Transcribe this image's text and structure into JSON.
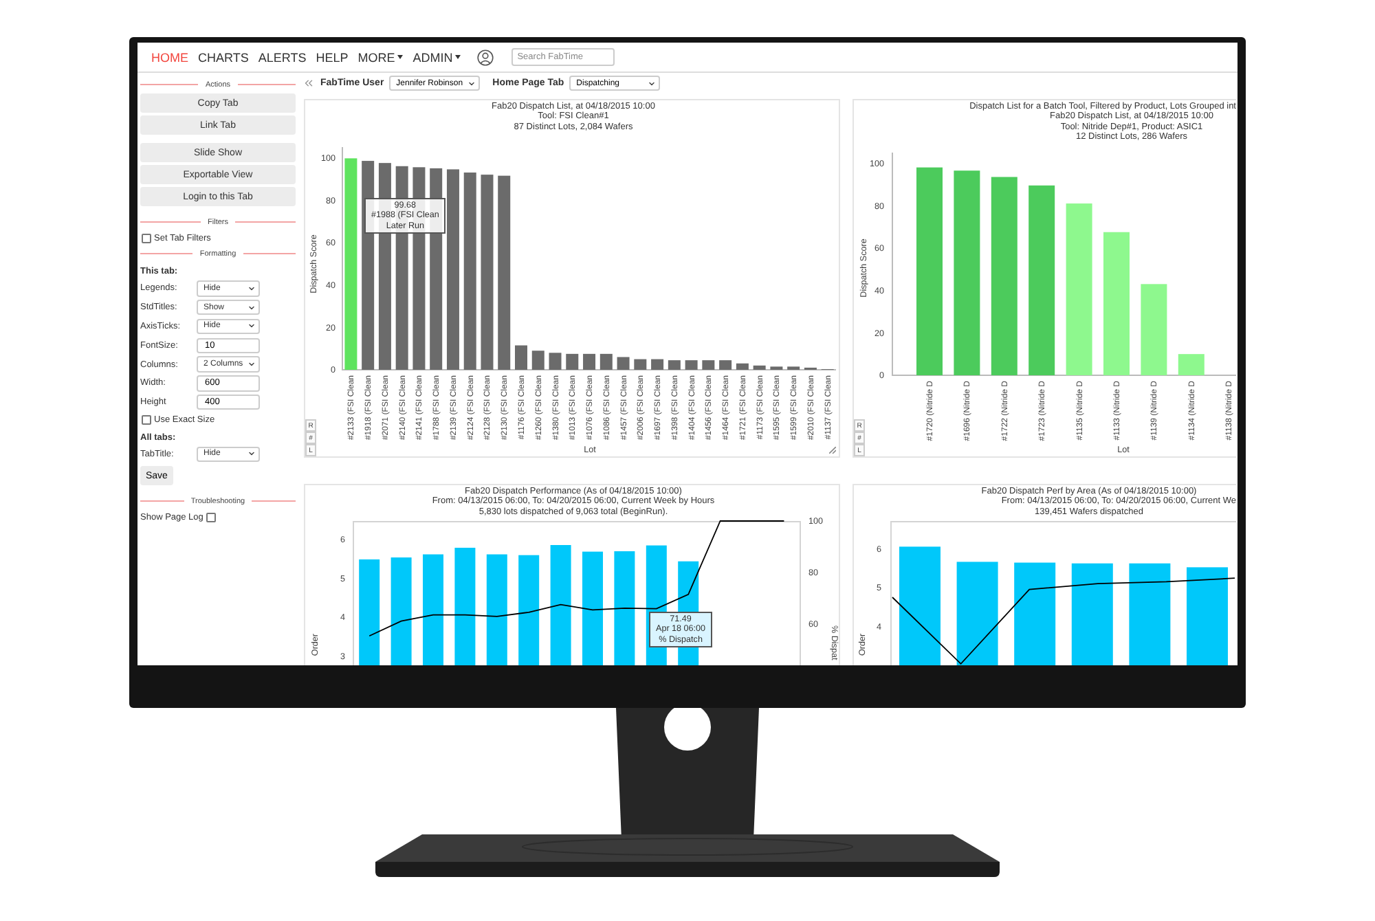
{
  "nav": {
    "items": [
      {
        "label": "HOME",
        "selected": true,
        "dropdown": false
      },
      {
        "label": "CHARTS",
        "selected": false,
        "dropdown": false
      },
      {
        "label": "ALERTS",
        "selected": false,
        "dropdown": false
      },
      {
        "label": "HELP",
        "selected": false,
        "dropdown": false
      },
      {
        "label": "MORE",
        "selected": false,
        "dropdown": true
      },
      {
        "label": "ADMIN",
        "selected": false,
        "dropdown": true
      }
    ],
    "search": {
      "placeholder": "Search FabTime"
    }
  },
  "sidebar": {
    "sections": [
      {
        "title": "Actions",
        "items": [
          {
            "kind": "button-group",
            "buttons": [
              "Copy Tab",
              "Link Tab"
            ]
          },
          {
            "kind": "button-group",
            "buttons": [
              "Slide Show",
              "Exportable View",
              "Login to this Tab"
            ]
          }
        ]
      },
      {
        "title": "Filters",
        "items": [
          {
            "kind": "checkbox",
            "label": "Set Tab Filters",
            "checked": false
          }
        ]
      },
      {
        "title": "Formatting",
        "items": [
          {
            "kind": "heading",
            "text": "This tab:"
          },
          {
            "kind": "select",
            "label": "Legends:",
            "value": "Hide"
          },
          {
            "kind": "select",
            "label": "StdTitles:",
            "value": "Show"
          },
          {
            "kind": "select",
            "label": "AxisTicks:",
            "value": "Hide"
          },
          {
            "kind": "input",
            "label": "FontSize:",
            "value": "10"
          },
          {
            "kind": "select",
            "label": "Columns:",
            "value": "2 Columns"
          },
          {
            "kind": "input",
            "label": "Width:",
            "value": "600"
          },
          {
            "kind": "input",
            "label": "Height",
            "value": "400"
          },
          {
            "kind": "checkbox",
            "label": "Use Exact Size",
            "checked": false
          },
          {
            "kind": "heading",
            "text": "All tabs:"
          },
          {
            "kind": "select",
            "label": "TabTitle:",
            "value": "Hide"
          },
          {
            "kind": "submit",
            "label": "Save"
          }
        ]
      },
      {
        "title": "Troubleshooting",
        "items": [
          {
            "kind": "checkbox-right",
            "label": "Show Page Log",
            "checked": false
          }
        ]
      }
    ]
  },
  "toolbar": {
    "fields": [
      {
        "label": "FabTime User",
        "value": "Jennifer Robinson"
      },
      {
        "label": "Home Page Tab",
        "value": "Dispatching"
      }
    ]
  },
  "charts": [
    {
      "title_lines": [
        "Fab20 Dispatch List, at 04/18/2015 10:00",
        "Tool: FSI Clean#1",
        "87 Distinct Lots, 2,084 Wafers"
      ],
      "side_buttons": [
        "R",
        "#",
        "L"
      ],
      "chart_data": {
        "type": "bar",
        "xlabel": "Lot",
        "ylabel": "Dispatch Score",
        "ylim": [
          0,
          105
        ],
        "yticks": [
          0,
          20,
          40,
          60,
          80,
          100
        ],
        "categories": [
          "#2133 (FSI Clean",
          "#1918 (FSI Clean",
          "#2071 (FSI Clean",
          "#2140 (FSI Clean",
          "#2141 (FSI Clean",
          "#1788 (FSI Clean",
          "#2139 (FSI Clean",
          "#2124 (FSI Clean",
          "#2128 (FSI Clean",
          "#2130 (FSI Clean",
          "#1176 (FSI Clean",
          "#1260 (FSI Clean",
          "#1380 (FSI Clean",
          "#1013 (FSI Clean",
          "#1076 (FSI Clean",
          "#1086 (FSI Clean",
          "#1457 (FSI Clean",
          "#2006 (FSI Clean",
          "#1697 (FSI Clean",
          "#1398 (FSI Clean",
          "#1404 (FSI Clean",
          "#1456 (FSI Clean",
          "#1464 (FSI Clean",
          "#1721 (FSI Clean",
          "#1173 (FSI Clean",
          "#1595 (FSI Clean",
          "#1599 (FSI Clean",
          "#2010 (FSI Clean",
          "#1137 (FSI Clean"
        ],
        "series": [
          {
            "color": "#5ee35e",
            "values": [
              99.7,
              null,
              null,
              null,
              null,
              null,
              null,
              null,
              null,
              null,
              null,
              null,
              null,
              null,
              null,
              null,
              null,
              null,
              null,
              null,
              null,
              null,
              null,
              null,
              null,
              null,
              null,
              null,
              null
            ]
          },
          {
            "color": "#6b6b6b",
            "values": [
              null,
              98.5,
              97.5,
              96,
              95.5,
              95,
              94.5,
              93,
              92,
              91.5,
              11.5,
              9,
              8,
              7.5,
              7.5,
              7.5,
              6,
              5,
              5,
              4.5,
              4.5,
              4.5,
              4.5,
              3,
              2,
              1.5,
              1.5,
              1,
              0.3
            ]
          }
        ],
        "annotations": [
          {
            "text": "99.68\n#1988 (FSI Clean\nLater Run"
          }
        ]
      }
    },
    {
      "title_lines": [
        "Dispatch List for a Batch Tool, Filtered by Product, Lots Grouped int",
        "Fab20 Dispatch List, at 04/18/2015 10:00",
        "Tool: Nitride Dep#1, Product: ASIC1",
        "12 Distinct Lots, 286 Wafers"
      ],
      "side_buttons": [
        "R",
        "#",
        "L"
      ],
      "chart_data": {
        "type": "bar",
        "xlabel": "Lot",
        "ylabel": "Dispatch Score",
        "ylim": [
          0,
          105
        ],
        "yticks": [
          0,
          20,
          40,
          60,
          80,
          100
        ],
        "categories": [
          "#1720 (Nitride D",
          "#1696 (Nitride D",
          "#1722 (Nitride D",
          "#1723 (Nitride D",
          "#1135 (Nitride D",
          "#1133 (Nitride D",
          "#1139 (Nitride D",
          "#1134 (Nitride D",
          "#1138 (Nitride D"
        ],
        "series": [
          {
            "color": "#4ccb5c",
            "values": [
              98,
              96.5,
              93.5,
              89.5,
              null,
              null,
              null,
              null,
              null
            ]
          },
          {
            "color": "#8ef88e",
            "values": [
              null,
              null,
              null,
              null,
              81,
              67.5,
              43,
              10,
              null
            ]
          }
        ]
      }
    },
    {
      "title_lines": [
        "Fab20 Dispatch Performance  (As of 04/18/2015 10:00)",
        "From: 04/13/2015 06:00, To: 04/20/2015 06:00, Current Week by Hours",
        "5,830 lots dispatched of 9,063 total (BeginRun)."
      ],
      "chart_data": {
        "type": "bar",
        "ylabel": "Order",
        "y2label": "% Dispat",
        "ylim": [
          2.76,
          6.48
        ],
        "yticks": [
          3,
          4,
          5,
          6
        ],
        "y2lim": [
          44,
          100
        ],
        "y2ticks": [
          60,
          80,
          100
        ],
        "series": [
          {
            "type": "bar",
            "color": "#00c8fa",
            "values": [
              5.49,
              5.54,
              5.62,
              5.79,
              5.62,
              5.6,
              5.86,
              5.69,
              5.7,
              5.85,
              5.44,
              null,
              null,
              null
            ]
          },
          {
            "type": "line",
            "axis": "y2",
            "color": "#000000",
            "values": [
              55.4,
              61.2,
              63.6,
              63.6,
              63,
              64.6,
              67.6,
              65.5,
              66.2,
              66,
              71.5,
              100,
              100,
              100
            ]
          }
        ],
        "annotations": [
          {
            "text": "71.49\nApr 18 06:00\n% Dispatch"
          }
        ]
      }
    },
    {
      "title_lines": [
        "Fab20 Dispatch Perf by Area  (As of 04/18/2015 10:00)",
        "From: 04/13/2015 06:00, To: 04/20/2015 06:00, Current We",
        "139,451 Wafers dispatched"
      ],
      "chart_data": {
        "type": "bar",
        "ylabel": "Order",
        "ylim": [
          3,
          6.71
        ],
        "yticks": [
          4,
          5,
          6
        ],
        "series": [
          {
            "type": "bar",
            "color": "#00c8fa",
            "values": [
              6.05,
              5.66,
              5.64,
              5.62,
              5.62,
              5.52
            ]
          },
          {
            "type": "line",
            "color": "#000000",
            "values": [
              4.75,
              3.04,
              4.95,
              5.1,
              5.15,
              5.24
            ]
          }
        ]
      }
    }
  ]
}
